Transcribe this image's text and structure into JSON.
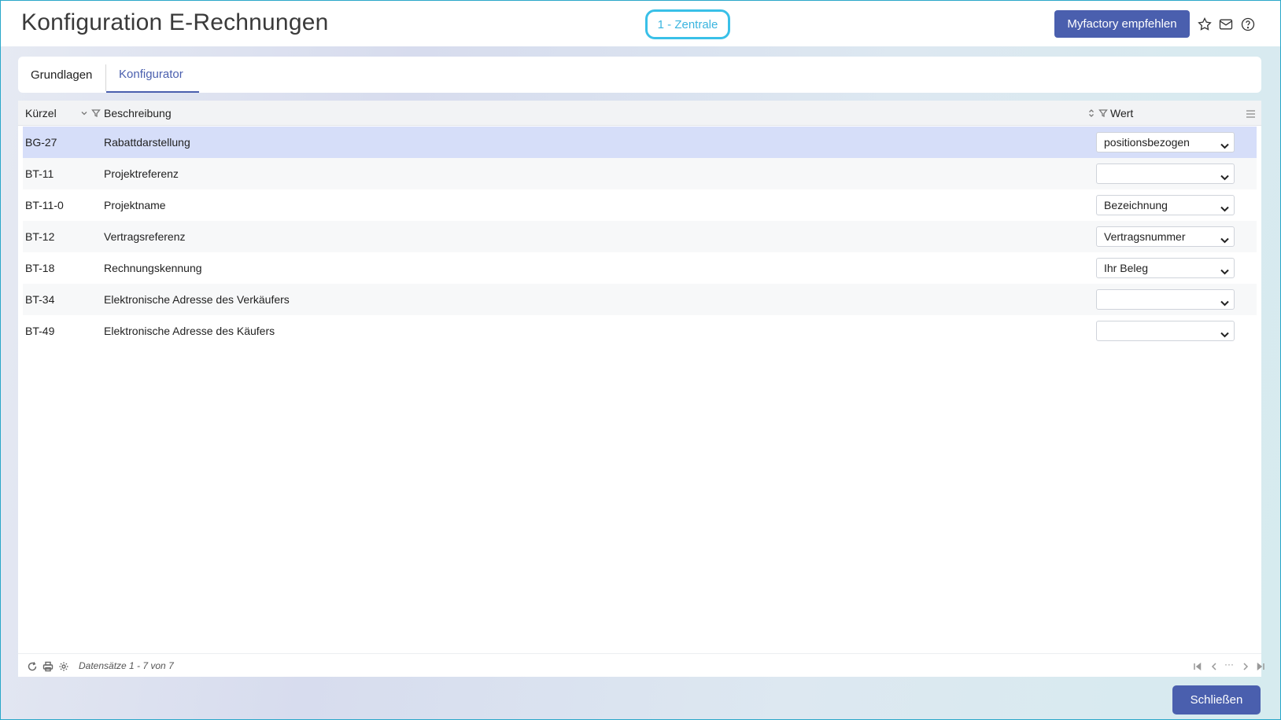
{
  "header": {
    "title": "Konfiguration E-Rechnungen",
    "branch": "1 - Zentrale",
    "recommend_label": "Myfactory empfehlen",
    "icons": [
      "star-icon",
      "mail-icon",
      "help-icon"
    ]
  },
  "tabs": [
    {
      "label": "Grundlagen",
      "active": false
    },
    {
      "label": "Konfigurator",
      "active": true
    }
  ],
  "grid": {
    "columns": {
      "kuerzel": "Kürzel",
      "beschreibung": "Beschreibung",
      "wert": "Wert"
    },
    "rows": [
      {
        "kuerzel": "BG-27",
        "beschreibung": "Rabattdarstellung",
        "wert": "positionsbezogen",
        "selected": true
      },
      {
        "kuerzel": "BT-11",
        "beschreibung": "Projektreferenz",
        "wert": ""
      },
      {
        "kuerzel": "BT-11-0",
        "beschreibung": "Projektname",
        "wert": "Bezeichnung"
      },
      {
        "kuerzel": "BT-12",
        "beschreibung": "Vertragsreferenz",
        "wert": "Vertragsnummer"
      },
      {
        "kuerzel": "BT-18",
        "beschreibung": "Rechnungskennung",
        "wert": "Ihr Beleg"
      },
      {
        "kuerzel": "BT-34",
        "beschreibung": "Elektronische Adresse des Verkäufers",
        "wert": ""
      },
      {
        "kuerzel": "BT-49",
        "beschreibung": "Elektronische Adresse des Käufers",
        "wert": ""
      }
    ],
    "footer": {
      "records": "Datensätze 1 - 7 von 7",
      "pager_ellipsis": "···"
    }
  },
  "actions": {
    "close_label": "Schließen"
  },
  "colors": {
    "accent": "#4a5fae",
    "selected_row": "#d6def9",
    "branch_border": "#39c0e8"
  }
}
